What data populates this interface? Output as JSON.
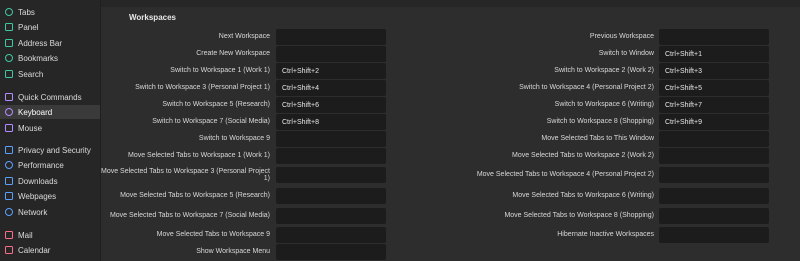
{
  "sidebar": {
    "items": [
      {
        "label": "Tabs",
        "icon": "tabs-icon",
        "color": "#3ec9a0",
        "active": false
      },
      {
        "label": "Panel",
        "icon": "panel-icon",
        "color": "#3ec9a0",
        "active": false
      },
      {
        "label": "Address Bar",
        "icon": "address-bar-icon",
        "color": "#3ec9a0",
        "active": false
      },
      {
        "label": "Bookmarks",
        "icon": "bookmarks-icon",
        "color": "#3ec9a0",
        "active": false
      },
      {
        "label": "Search",
        "icon": "search-icon",
        "color": "#3ec9a0",
        "active": false
      },
      {
        "label": "Quick Commands",
        "icon": "quick-commands-icon",
        "color": "#b58cff",
        "active": false
      },
      {
        "label": "Keyboard",
        "icon": "keyboard-icon",
        "color": "#b58cff",
        "active": true
      },
      {
        "label": "Mouse",
        "icon": "mouse-icon",
        "color": "#b58cff",
        "active": false
      },
      {
        "label": "Privacy and Security",
        "icon": "privacy-icon",
        "color": "#5aa0ff",
        "active": false
      },
      {
        "label": "Performance",
        "icon": "performance-icon",
        "color": "#5aa0ff",
        "active": false
      },
      {
        "label": "Downloads",
        "icon": "downloads-icon",
        "color": "#5aa0ff",
        "active": false
      },
      {
        "label": "Webpages",
        "icon": "webpages-icon",
        "color": "#5aa0ff",
        "active": false
      },
      {
        "label": "Network",
        "icon": "network-icon",
        "color": "#5aa0ff",
        "active": false
      },
      {
        "label": "Mail",
        "icon": "mail-icon",
        "color": "#ff6b8a",
        "active": false
      },
      {
        "label": "Calendar",
        "icon": "calendar-icon",
        "color": "#ff6b8a",
        "active": false
      }
    ]
  },
  "section": {
    "title": "Workspaces"
  },
  "left_rows": [
    {
      "label": "Next Workspace",
      "shortcut": ""
    },
    {
      "label": "Create New Workspace",
      "shortcut": ""
    },
    {
      "label": "Switch to Workspace 1 (Work 1)",
      "shortcut": "Ctrl+Shift+2"
    },
    {
      "label": "Switch to Workspace 3 (Personal Project 1)",
      "shortcut": "Ctrl+Shift+4"
    },
    {
      "label": "Switch to Workspace 5 (Research)",
      "shortcut": "Ctrl+Shift+6"
    },
    {
      "label": "Switch to Workspace 7 (Social Media)",
      "shortcut": "Ctrl+Shift+8"
    },
    {
      "label": "Switch to Workspace 9",
      "shortcut": ""
    },
    {
      "label": "Move Selected Tabs to Workspace 1 (Work 1)",
      "shortcut": ""
    },
    {
      "label": "Move Selected Tabs to Workspace 3 (Personal Project 1)",
      "shortcut": ""
    },
    {
      "label": "Move Selected Tabs to Workspace 5 (Research)",
      "shortcut": ""
    },
    {
      "label": "Move Selected Tabs to Workspace 7 (Social Media)",
      "shortcut": ""
    },
    {
      "label": "Move Selected Tabs to Workspace 9",
      "shortcut": ""
    },
    {
      "label": "Show Workspace Menu",
      "shortcut": ""
    }
  ],
  "right_rows": [
    {
      "label": "Previous Workspace",
      "shortcut": ""
    },
    {
      "label": "Switch to Window",
      "shortcut": "Ctrl+Shift+1"
    },
    {
      "label": "Switch to Workspace 2 (Work 2)",
      "shortcut": "Ctrl+Shift+3"
    },
    {
      "label": "Switch to Workspace 4 (Personal Project 2)",
      "shortcut": "Ctrl+Shift+5"
    },
    {
      "label": "Switch to Workspace 6 (Writing)",
      "shortcut": "Ctrl+Shift+7"
    },
    {
      "label": "Switch to Workspace 8 (Shopping)",
      "shortcut": "Ctrl+Shift+9"
    },
    {
      "label": "Move Selected Tabs to This Window",
      "shortcut": ""
    },
    {
      "label": "Move Selected Tabs to Workspace 2 (Work 2)",
      "shortcut": ""
    },
    {
      "label": "Move Selected Tabs to Workspace 4 (Personal Project 2)",
      "shortcut": ""
    },
    {
      "label": "Move Selected Tabs to Workspace 6 (Writing)",
      "shortcut": ""
    },
    {
      "label": "Move Selected Tabs to Workspace 8 (Shopping)",
      "shortcut": ""
    },
    {
      "label": "Hibernate Inactive Workspaces",
      "shortcut": ""
    }
  ]
}
